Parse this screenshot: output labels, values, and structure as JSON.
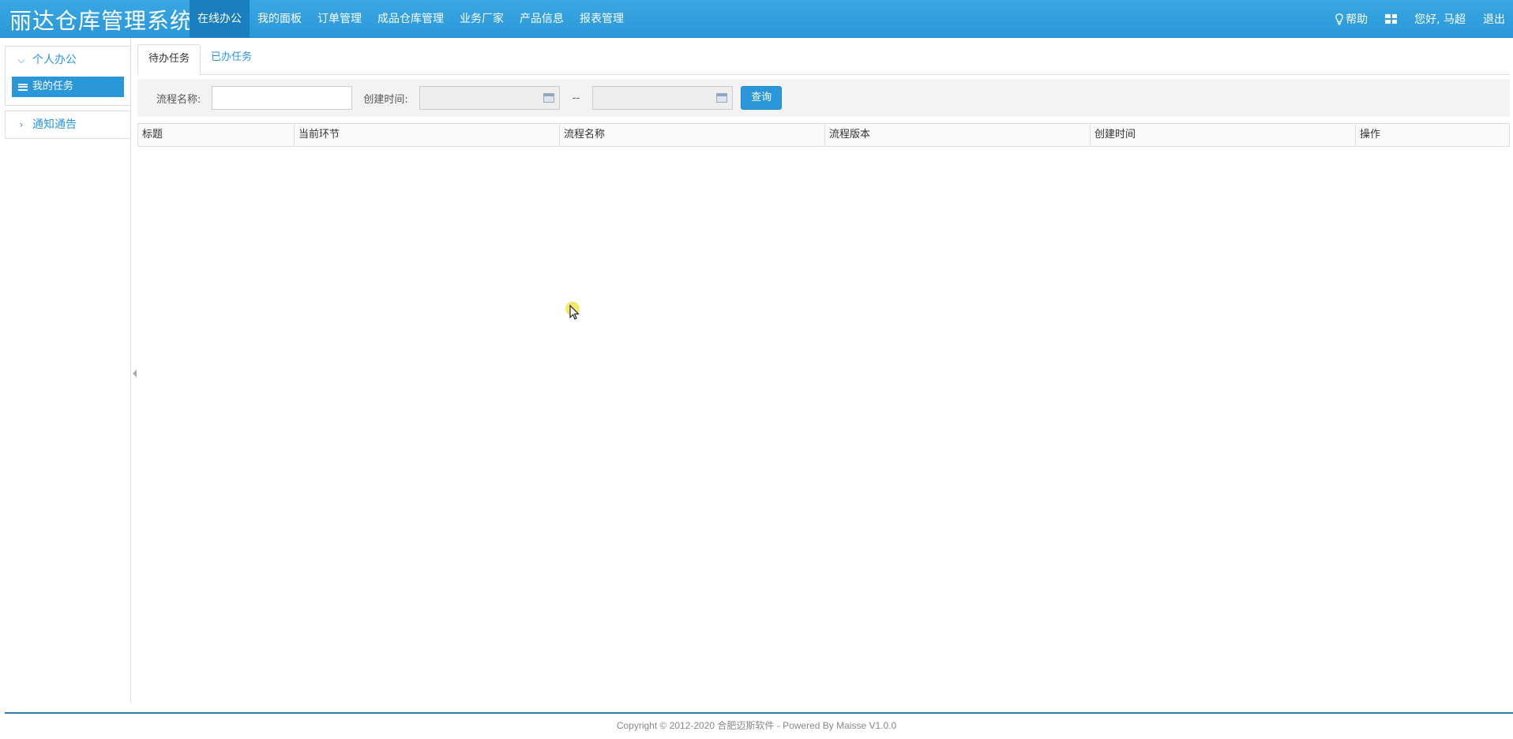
{
  "app": {
    "title": "丽达仓库管理系统"
  },
  "nav": {
    "items": [
      {
        "label": "在线办公",
        "active": true
      },
      {
        "label": "我的面板"
      },
      {
        "label": "订单管理"
      },
      {
        "label": "成品仓库管理"
      },
      {
        "label": "业务厂家"
      },
      {
        "label": "产品信息"
      },
      {
        "label": "报表管理"
      }
    ],
    "help_label": "帮助",
    "greeting": "您好, 马超",
    "logout_label": "退出"
  },
  "sidebar": {
    "group1": {
      "label": "个人办公",
      "expanded": true
    },
    "group1_items": [
      {
        "label": "我的任务",
        "active": true
      }
    ],
    "group2": {
      "label": "通知通告",
      "expanded": false
    }
  },
  "tabs": [
    {
      "label": "待办任务",
      "active": true
    },
    {
      "label": "已办任务"
    }
  ],
  "search": {
    "process_name_label": "流程名称:",
    "process_name_value": "",
    "created_time_label": "创建时间:",
    "range_separator": "--",
    "query_button": "查询"
  },
  "table": {
    "columns": [
      "标题",
      "当前环节",
      "流程名称",
      "流程版本",
      "创建时间",
      "操作"
    ],
    "rows": []
  },
  "footer": {
    "copyright": "Copyright © 2012-2020 合肥迈斯软件 - Powered By Maisse V1.0.0"
  },
  "colors": {
    "primary": "#2a97d8",
    "nav_active": "#1a7fbf"
  }
}
